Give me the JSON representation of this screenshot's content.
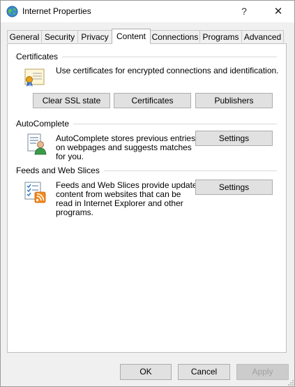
{
  "window": {
    "title": "Internet Properties",
    "help_glyph": "?",
    "close_glyph": "✕"
  },
  "tabs": [
    {
      "label": "General"
    },
    {
      "label": "Security"
    },
    {
      "label": "Privacy"
    },
    {
      "label": "Content",
      "active": true
    },
    {
      "label": "Connections"
    },
    {
      "label": "Programs"
    },
    {
      "label": "Advanced"
    }
  ],
  "certificates": {
    "title": "Certificates",
    "description": "Use certificates for encrypted connections and identification.",
    "buttons": {
      "clear_ssl": "Clear SSL state",
      "certificates": "Certificates",
      "publishers": "Publishers"
    },
    "icon": "certificate-icon"
  },
  "autocomplete": {
    "title": "AutoComplete",
    "description_lines": [
      "AutoComplete stores previous entries",
      "on webpages and suggests matches",
      "for you."
    ],
    "settings": "Settings",
    "icon": "autocomplete-icon"
  },
  "feeds": {
    "title": "Feeds and Web Slices",
    "description_lines": [
      "Feeds and Web Slices provide updated",
      "content from websites that can be",
      "read in Internet Explorer and other",
      "programs."
    ],
    "settings": "Settings",
    "icon": "feeds-icon"
  },
  "footer": {
    "ok": "OK",
    "cancel": "Cancel",
    "apply": "Apply",
    "apply_disabled": true
  },
  "colors": {
    "window_bg": "#f0f0f0",
    "panel_bg": "#ffffff",
    "button_bg": "#e1e1e1",
    "disabled_text": "#a0a0a0"
  }
}
